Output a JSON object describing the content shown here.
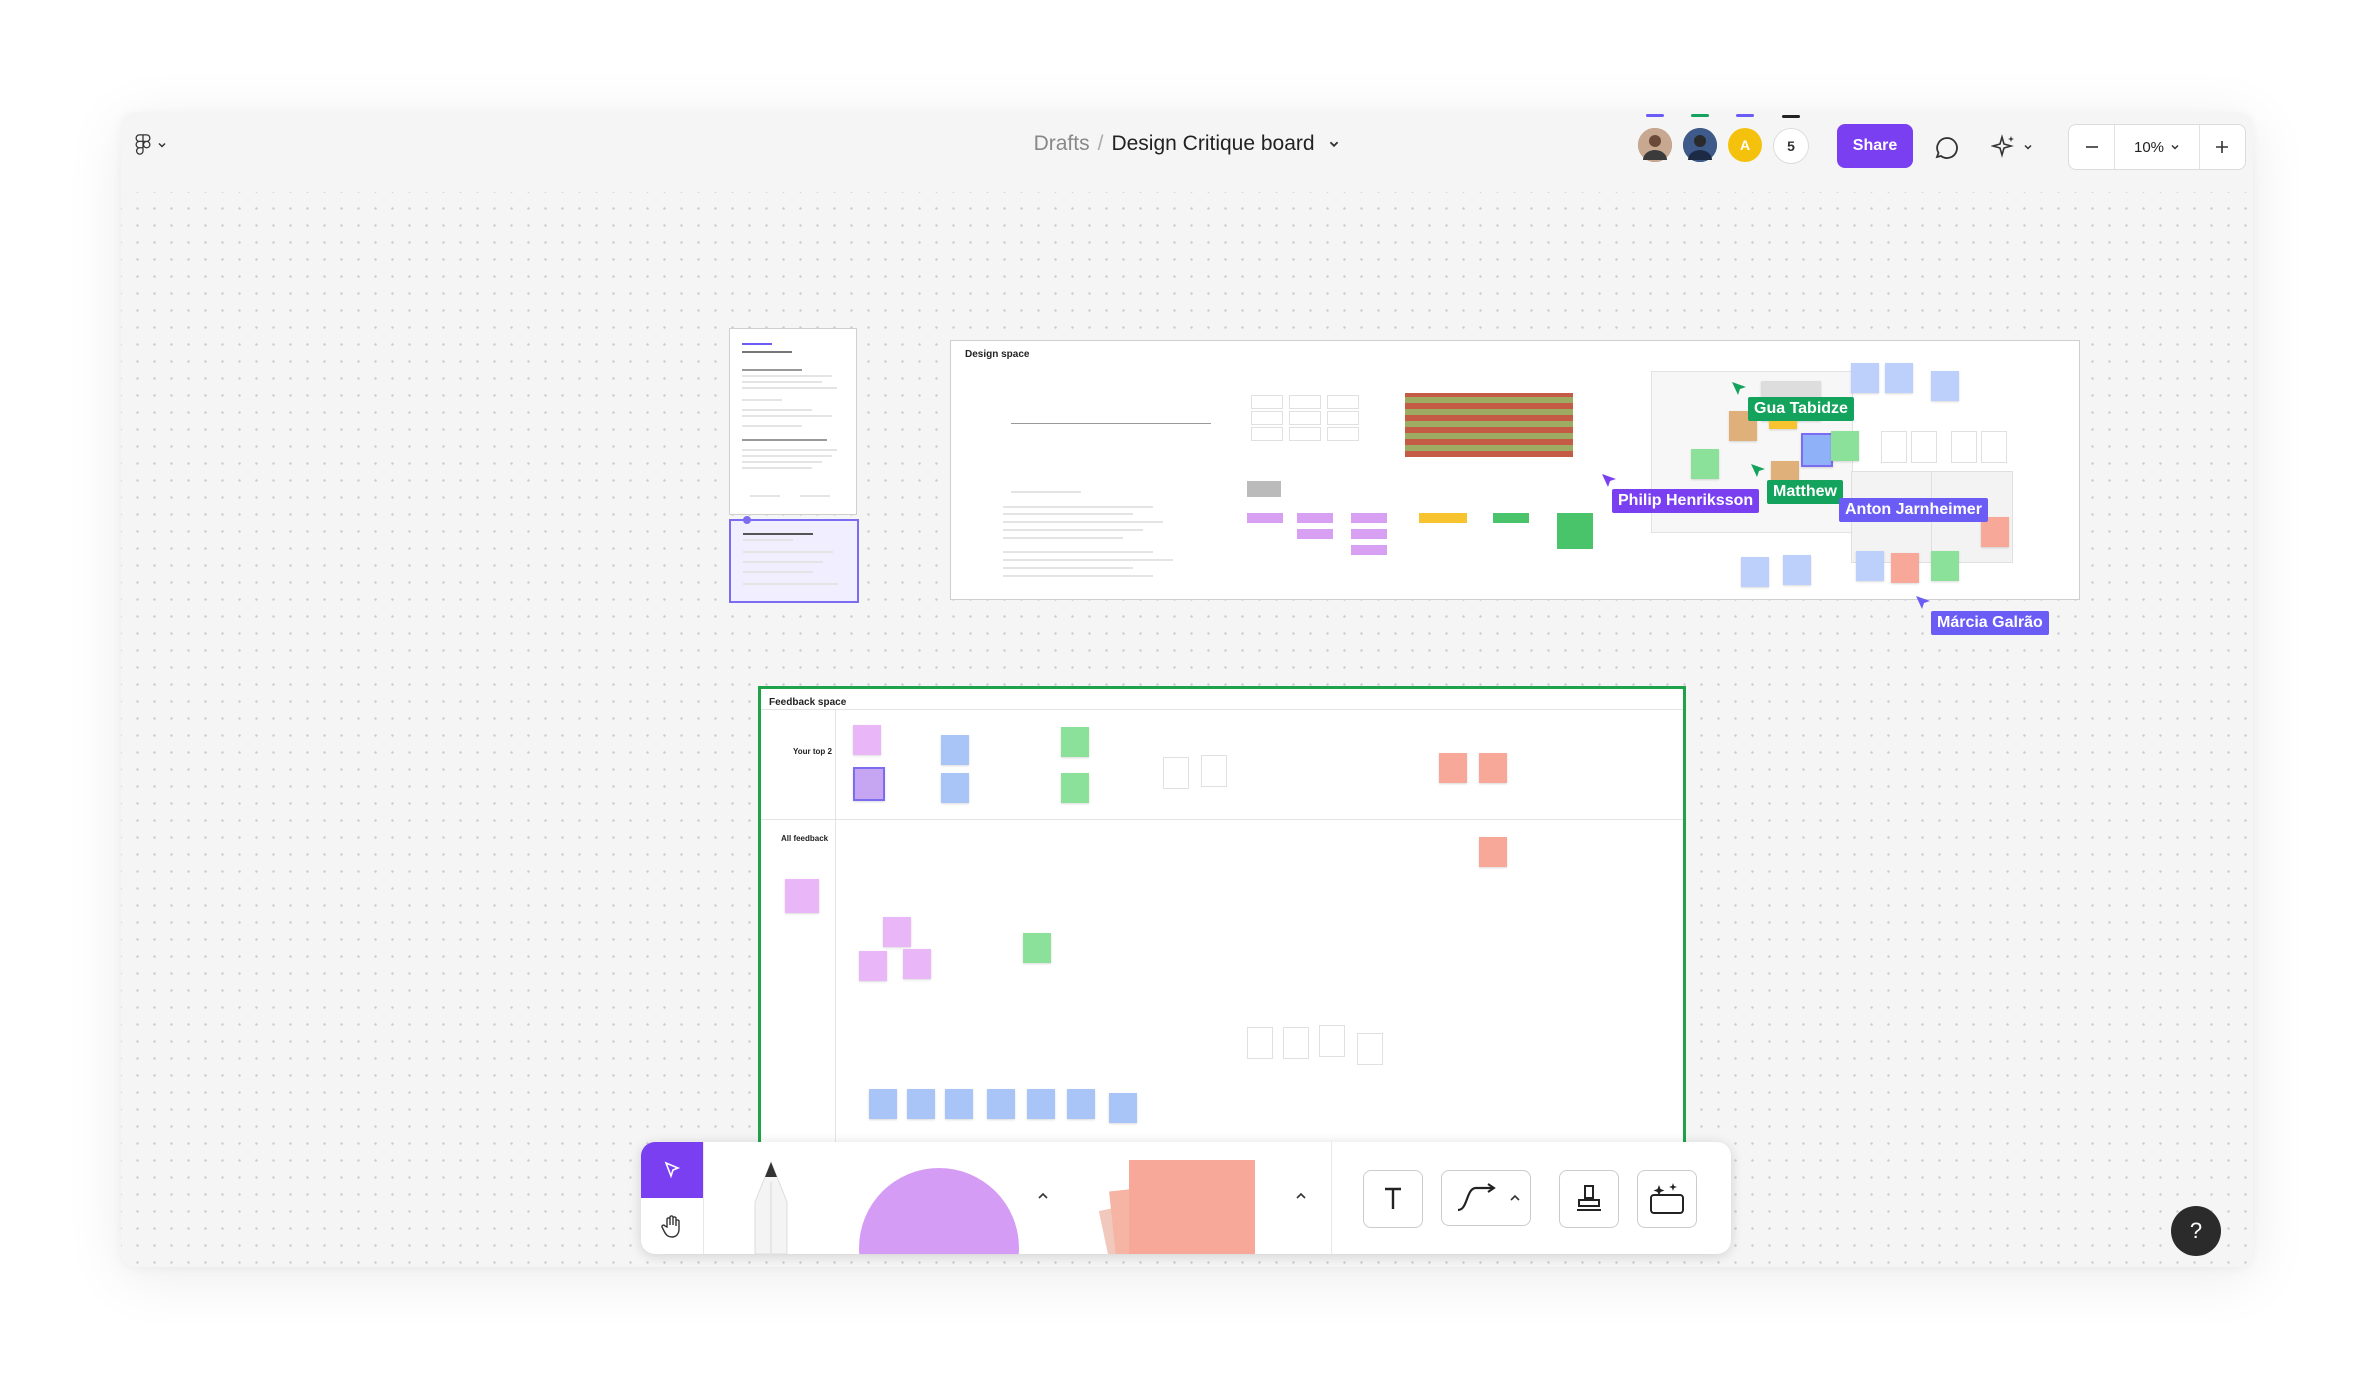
{
  "header": {
    "menu_icon": "figma-logo-icon",
    "breadcrumb_parent": "Drafts",
    "breadcrumb_separator": "/",
    "file_title": "Design Critique board",
    "participants_count": "5",
    "avatar_initial": "A",
    "share_label": "Share",
    "zoom_level": "10%"
  },
  "canvas": {
    "design_frame_title": "Design space",
    "feedback_frame_title": "Feedback space",
    "feedback_row1_heading": "Your top 2",
    "feedback_row2_heading": "All feedback"
  },
  "cursors": [
    {
      "name": "Gua Tabidze",
      "color": "#14a35c"
    },
    {
      "name": "Philip Henriksson",
      "color": "#7b3ff2"
    },
    {
      "name": "Matthew",
      "color": "#14a35c"
    },
    {
      "name": "Anton Jarnheimer",
      "color": "#6a5cf5"
    },
    {
      "name": "Márcia Galrão",
      "color": "#6a5cf5"
    }
  ],
  "toolbar": {
    "tools": [
      "move-tool",
      "hand-tool",
      "pencil-tool",
      "shape-tool",
      "sticky-tool",
      "text-tool",
      "connector-tool",
      "stamp-tool",
      "widgets-tool"
    ]
  },
  "help_label": "?",
  "colors": {
    "accent": "#7b3ff2",
    "feedback_frame_border": "#1ea34a",
    "sticky_pink": "#f7a898",
    "shape_purple": "#d59cf5"
  }
}
